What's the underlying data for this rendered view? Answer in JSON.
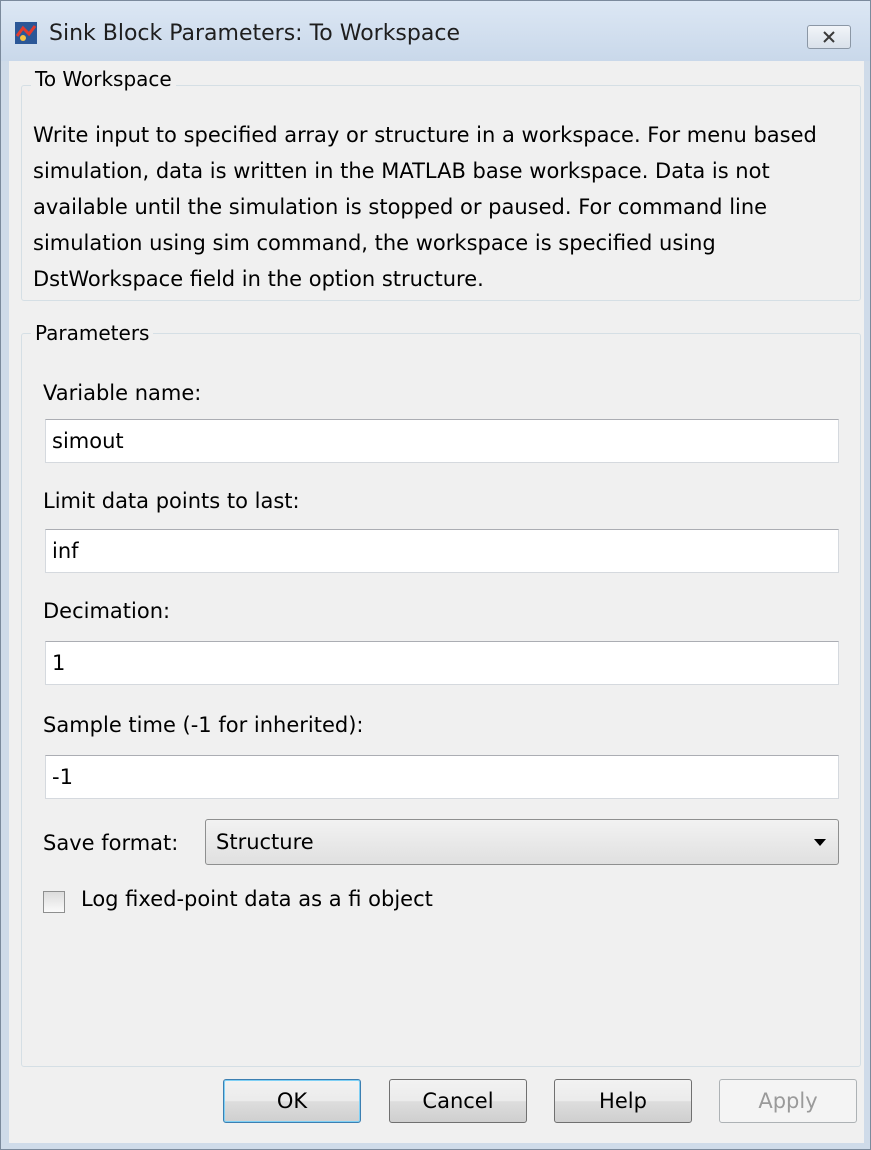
{
  "window": {
    "title": "Sink Block Parameters: To Workspace",
    "close_icon": "close-icon"
  },
  "description_group": {
    "title": "To Workspace",
    "text": "Write input to specified array or structure in a workspace. For menu based simulation, data is written in the MATLAB base workspace. Data is not available until the simulation is stopped or paused. For command line simulation using sim command, the workspace is specified using DstWorkspace field in the option structure."
  },
  "parameters": {
    "title": "Parameters",
    "variable_name": {
      "label": "Variable name:",
      "value": "simout"
    },
    "limit_points": {
      "label": "Limit data points to last:",
      "value": "inf"
    },
    "decimation": {
      "label": "Decimation:",
      "value": "1"
    },
    "sample_time": {
      "label": "Sample time (-1 for inherited):",
      "value": "-1"
    },
    "save_format": {
      "label": "Save format:",
      "selected": "Structure"
    },
    "log_fixed_point": {
      "label": "Log fixed-point data as a fi object",
      "checked": false
    }
  },
  "buttons": {
    "ok": "OK",
    "cancel": "Cancel",
    "help": "Help",
    "apply": "Apply"
  },
  "colors": {
    "title_bar": "#cfdbe9",
    "dialog_bg": "#f0f0f0",
    "default_button_border": "#3c7fb1"
  }
}
